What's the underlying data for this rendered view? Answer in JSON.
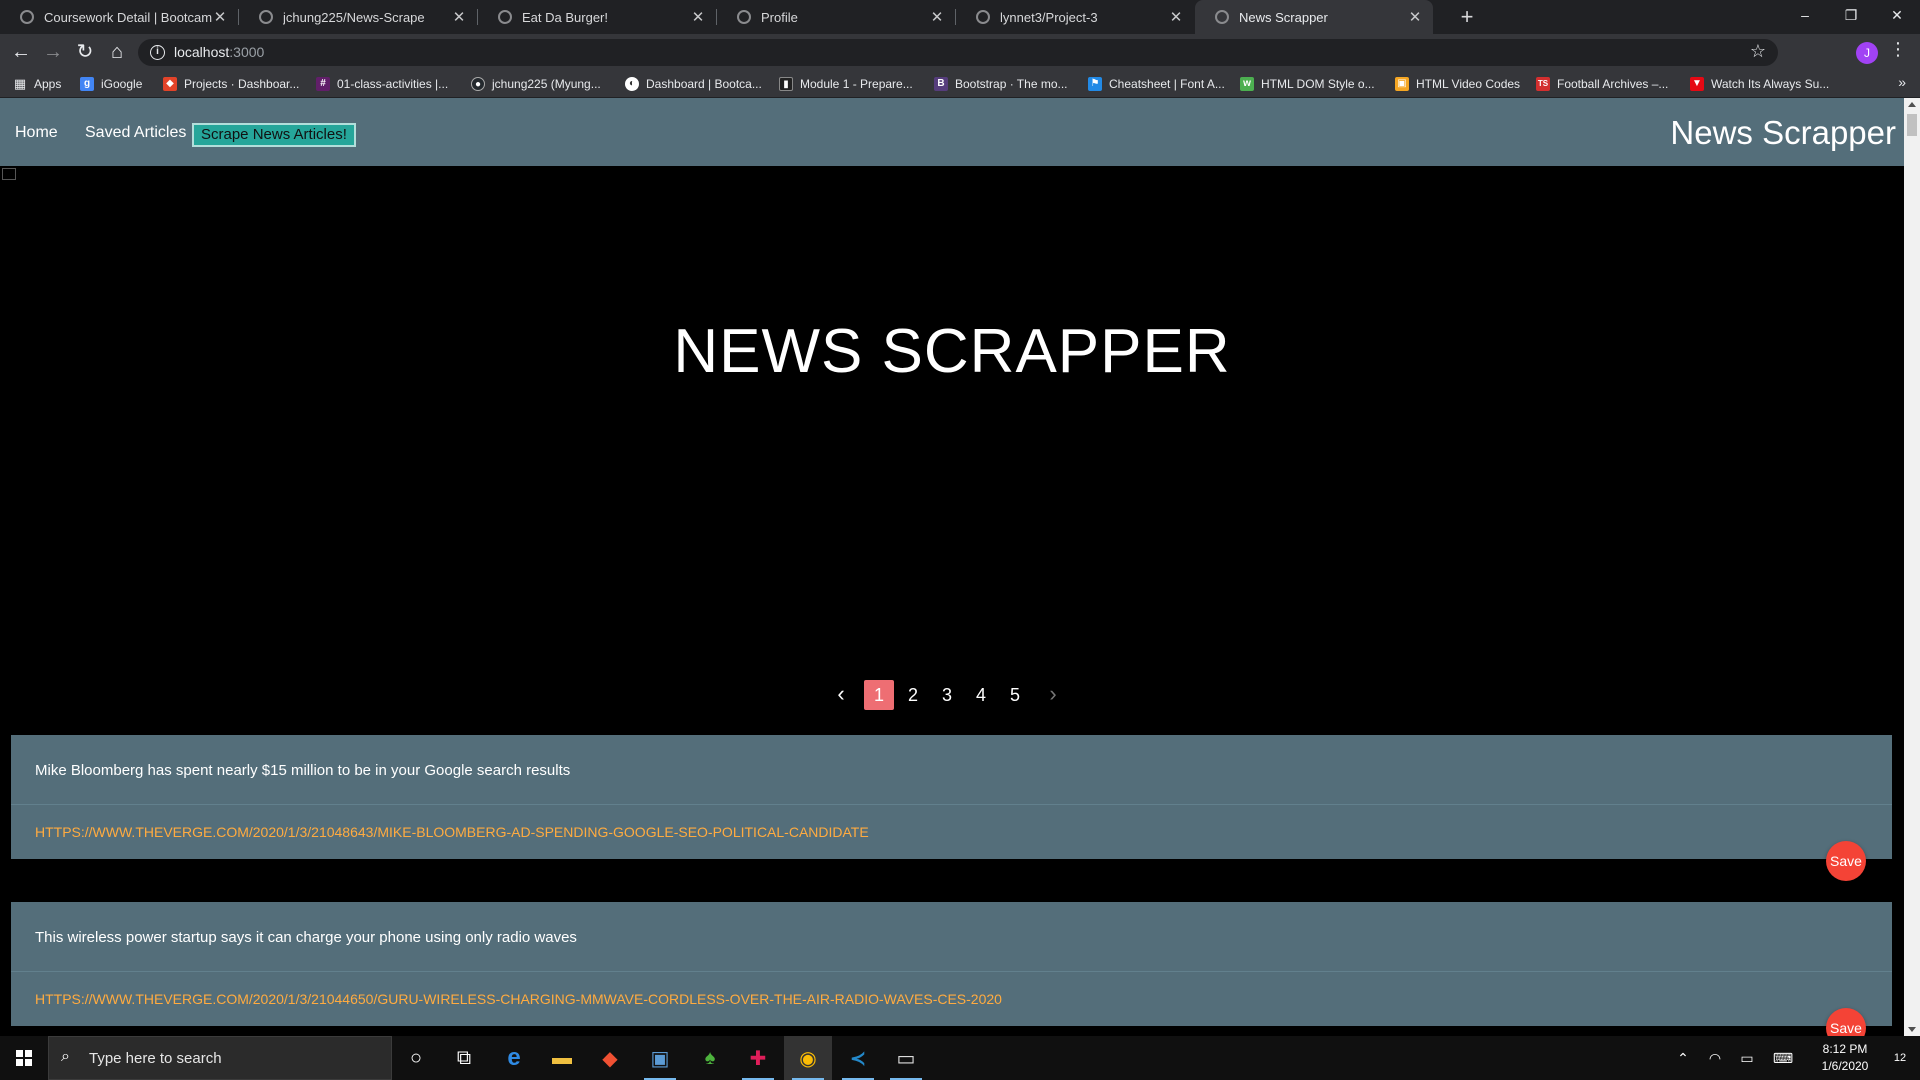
{
  "browser": {
    "tabs": [
      {
        "title": "Coursework Detail | Bootcamp Sp"
      },
      {
        "title": "jchung225/News-Scrape"
      },
      {
        "title": "Eat Da Burger!"
      },
      {
        "title": "Profile"
      },
      {
        "title": "lynnet3/Project-3"
      },
      {
        "title": "News Scrapper"
      }
    ],
    "url": "localhost",
    "url_port": ":3000",
    "profile_initial": "J",
    "bookmarks": [
      {
        "label": "Apps",
        "color": "#e8eaed"
      },
      {
        "label": "iGoogle",
        "color": "#4285f4"
      },
      {
        "label": "Projects · Dashboar...",
        "color": "#e24329"
      },
      {
        "label": "01-class-activities |...",
        "color": "#611f69"
      },
      {
        "label": "jchung225 (Myung...",
        "color": "#24292e"
      },
      {
        "label": "Dashboard | Bootca...",
        "color": "#ffffff"
      },
      {
        "label": "Module 1 - Prepare...",
        "color": "#222222"
      },
      {
        "label": "Bootstrap · The mo...",
        "color": "#563d7c"
      },
      {
        "label": "Cheatsheet | Font A...",
        "color": "#228ae6"
      },
      {
        "label": "HTML DOM Style o...",
        "color": "#4caf50"
      },
      {
        "label": "HTML Video Codes",
        "color": "#f5a623"
      },
      {
        "label": "Football Archives –...",
        "color": "#d32f2f"
      },
      {
        "label": "Watch Its Always Su...",
        "color": "#e50914"
      }
    ]
  },
  "site": {
    "nav": {
      "home": "Home",
      "saved": "Saved Articles",
      "scrape": "Scrape News Articles!",
      "brand": "News Scrapper"
    },
    "hero_title": "NEWS SCRAPPER",
    "pagination": {
      "pages": [
        "1",
        "2",
        "3",
        "4",
        "5"
      ],
      "current_page": 1
    },
    "articles": [
      {
        "title": "Mike Bloomberg has spent nearly $15 million to be in your Google search results",
        "link": "HTTPS://WWW.THEVERGE.COM/2020/1/3/21048643/MIKE-BLOOMBERG-AD-SPENDING-GOOGLE-SEO-POLITICAL-CANDIDATE",
        "save_label": "Save"
      },
      {
        "title": "This wireless power startup says it can charge your phone using only radio waves",
        "link": "HTTPS://WWW.THEVERGE.COM/2020/1/3/21044650/GURU-WIRELESS-CHARGING-MMWAVE-CORDLESS-OVER-THE-AIR-RADIO-WAVES-CES-2020",
        "save_label": "Save"
      }
    ]
  },
  "taskbar": {
    "search_placeholder": "Type here to search",
    "time": "8:12 PM",
    "date": "1/6/2020",
    "notification_count": "12"
  },
  "colors": {
    "nav_bg": "#546e7a",
    "accent_teal": "#26a69a",
    "link_orange": "#ffab40",
    "save_red": "#f44336",
    "active_page": "#ee6e73"
  }
}
